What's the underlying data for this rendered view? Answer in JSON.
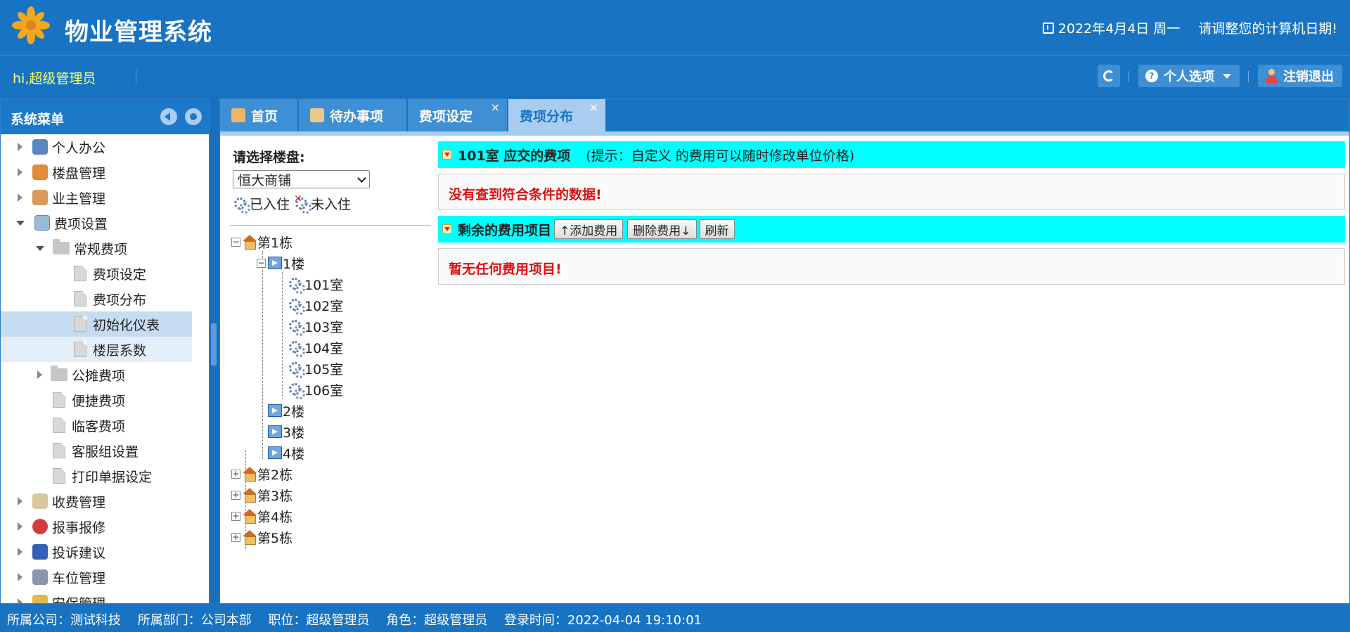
{
  "app": {
    "title": "物业管理系统"
  },
  "header": {
    "date": "2022年4月4日 周一",
    "warning": "请调整您的计算机日期!",
    "greeting": "hi,超级管理员",
    "personal_label": "个人选项",
    "logout_label": "注销退出"
  },
  "sidebar": {
    "title": "系统菜单",
    "items": [
      {
        "label": "个人办公"
      },
      {
        "label": "楼盘管理"
      },
      {
        "label": "业主管理"
      },
      {
        "label": "费项设置"
      },
      {
        "label": "常规费项"
      },
      {
        "label": "费项设定"
      },
      {
        "label": "费项分布"
      },
      {
        "label": "初始化仪表"
      },
      {
        "label": "楼层系数"
      },
      {
        "label": "公摊费项"
      },
      {
        "label": "便捷费项"
      },
      {
        "label": "临客费项"
      },
      {
        "label": "客服组设置"
      },
      {
        "label": "打印单据设定"
      },
      {
        "label": "收费管理"
      },
      {
        "label": "报事报修"
      },
      {
        "label": "投诉建议"
      },
      {
        "label": "车位管理"
      },
      {
        "label": "安保管理"
      }
    ]
  },
  "tabs": [
    {
      "label": "首页"
    },
    {
      "label": "待办事项"
    },
    {
      "label": "费项设定",
      "close": "×"
    },
    {
      "label": "费项分布",
      "close": "×"
    }
  ],
  "left_panel": {
    "pick_label": "请选择楼盘:",
    "estate_selected": "恒大商铺",
    "legend_occupied": "已入住",
    "legend_vacant": "未入住"
  },
  "tree": {
    "buildings": [
      "第1栋",
      "第2栋",
      "第3栋",
      "第4栋",
      "第5栋"
    ],
    "floors": [
      "1楼",
      "2楼",
      "3楼",
      "4楼"
    ],
    "rooms": [
      "101室",
      "102室",
      "103室",
      "104室",
      "105室",
      "106室"
    ]
  },
  "right_panel": {
    "due_title": "101室 应交的费项",
    "due_hint": "(提示：自定义 的费用可以随时修改单位价格)",
    "no_data": "没有查到符合条件的数据!",
    "remaining_title": "剩余的费用项目",
    "add_btn": "↑添加费用",
    "del_btn": "删除费用↓",
    "refresh_btn": "刷新",
    "no_items": "暂无任何费用项目!"
  },
  "statusbar": {
    "company": "所属公司：测试科技",
    "dept": "所属部门：公司本部",
    "position": "职位：超级管理员",
    "role": "角色：超级管理员",
    "login_time": "登录时间：2022-04-04 19:10:01"
  },
  "colors": {
    "header_blue": "#1874c3",
    "highlight_cyan": "#00ffff",
    "error_red": "#e01010",
    "greeting_yellow": "#ffff66"
  }
}
